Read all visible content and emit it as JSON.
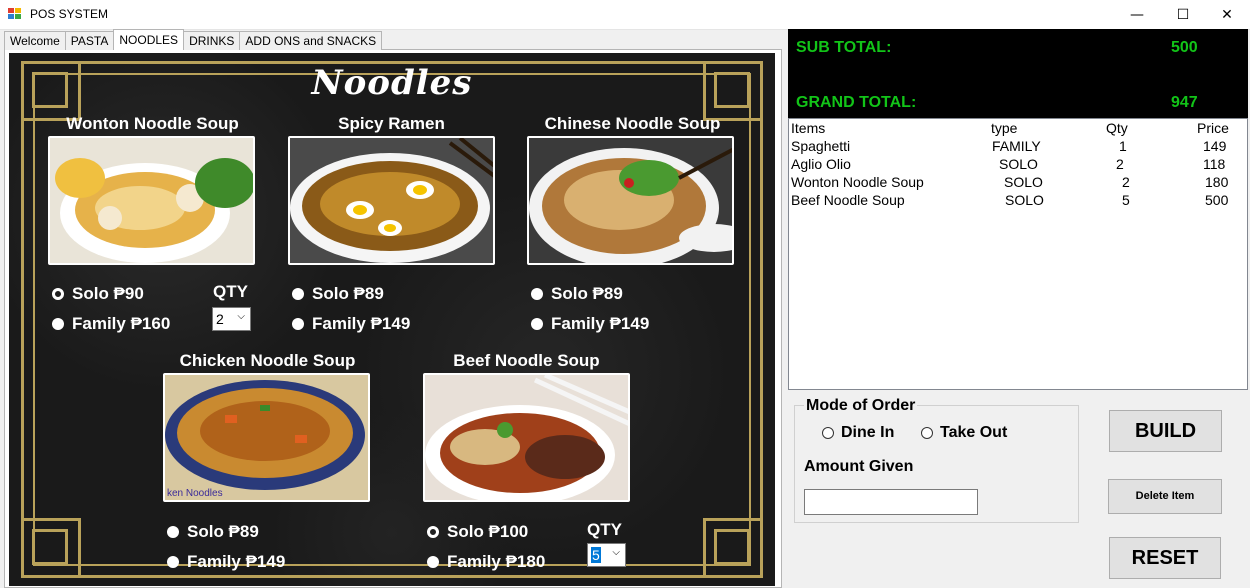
{
  "window": {
    "title": "POS SYSTEM",
    "minimize": "—",
    "maximize": "☐",
    "close": "✕"
  },
  "tabs": [
    "Welcome",
    "PASTA",
    "NOODLES",
    "DRINKS",
    "ADD ONS and SNACKS"
  ],
  "active_tab": "NOODLES",
  "board": {
    "title": "Noodles",
    "qty_label": "QTY",
    "items": [
      {
        "name": "Wonton Noodle Soup",
        "solo": "Solo ₱90",
        "family": "Family ₱160",
        "selected": "solo",
        "qty": "2"
      },
      {
        "name": "Spicy Ramen",
        "solo": "Solo ₱89",
        "family": "Family ₱149",
        "selected": ""
      },
      {
        "name": "Chinese Noodle Soup",
        "solo": "Solo ₱89",
        "family": "Family ₱149",
        "selected": ""
      },
      {
        "name": "Chicken Noodle Soup",
        "solo": "Solo ₱89",
        "family": "Family ₱149",
        "selected": "",
        "image_caption": "ken Noodles"
      },
      {
        "name": "Beef Noodle Soup",
        "solo": "Solo ₱100",
        "family": "Family ₱180",
        "selected": "solo",
        "qty": "5"
      }
    ]
  },
  "totals": {
    "sub_label": "SUB TOTAL:",
    "sub_value": "500",
    "grand_label": "GRAND TOTAL:",
    "grand_value": "947",
    "color": "#12c418"
  },
  "orders": {
    "headers": [
      "Items",
      "type",
      "Qty",
      "Price"
    ],
    "rows": [
      [
        "Spaghetti",
        "FAMILY",
        "1",
        "149"
      ],
      [
        "Aglio Olio",
        "SOLO",
        "2",
        "118"
      ],
      [
        "Wonton Noodle Soup",
        "SOLO",
        "2",
        "180"
      ],
      [
        "Beef Noodle Soup",
        "SOLO",
        "5",
        "500"
      ]
    ]
  },
  "mode": {
    "title": "Mode of Order",
    "dine_in": "Dine In",
    "take_out": "Take Out"
  },
  "amount": {
    "label": "Amount Given",
    "value": ""
  },
  "buttons": {
    "build": "BUILD",
    "delete": "Delete Item",
    "reset": "RESET"
  }
}
